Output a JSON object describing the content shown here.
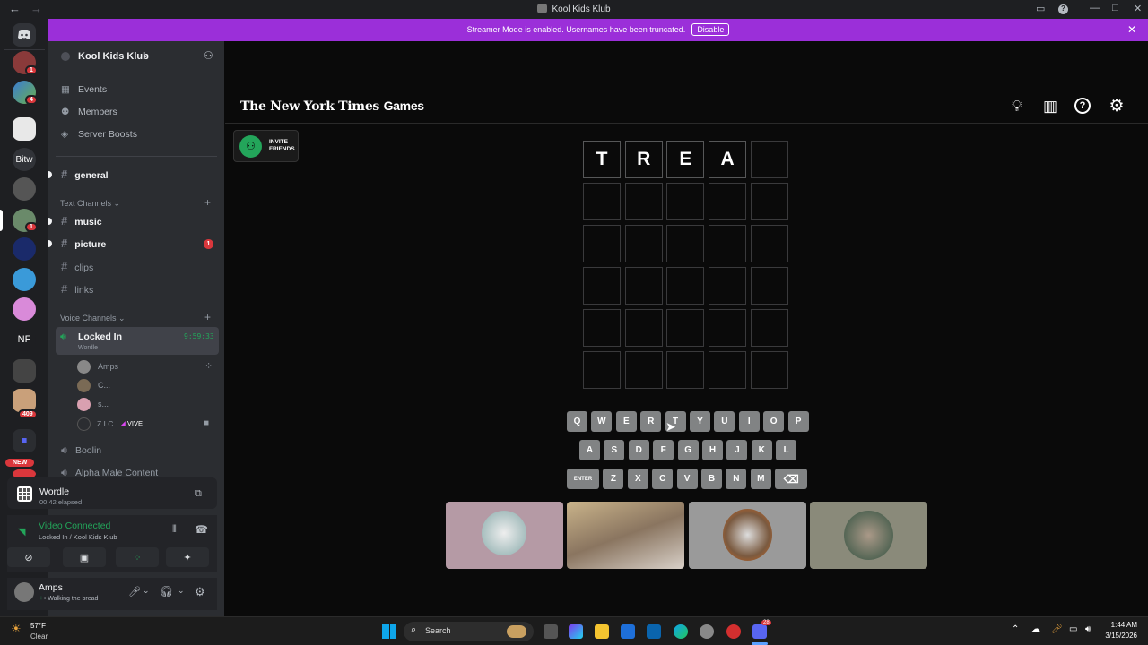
{
  "window": {
    "title": "Kool Kids Klub"
  },
  "banner": {
    "text": "Streamer Mode is enabled. Usernames have been truncated.",
    "button": "Disable"
  },
  "rail": {
    "text_server_1": "Bitw",
    "text_server_2": "NF",
    "new_badge": "NEW",
    "badge_1": "1",
    "badge_4": "4",
    "badge_409": "409"
  },
  "server": {
    "name": "Kool Kids Klub"
  },
  "nav": {
    "events": "Events",
    "members": "Members",
    "boosts": "Server Boosts"
  },
  "channels": {
    "general": "general",
    "text_category": "Text Channels",
    "text": [
      {
        "name": "music",
        "unread": true
      },
      {
        "name": "picture",
        "unread": true,
        "badge": "1"
      },
      {
        "name": "clips",
        "unread": false
      },
      {
        "name": "links",
        "unread": false
      }
    ],
    "voice_category": "Voice Channels",
    "voice_active": {
      "name": "Locked In",
      "activity": "Wordle",
      "timer": "9:59:33"
    },
    "voice_users": [
      {
        "name": "Amps"
      },
      {
        "name": "C..."
      },
      {
        "name": "s..."
      },
      {
        "name": "Z.I.C",
        "tag": "VIVE"
      }
    ],
    "voice_other": [
      {
        "name": "Boolin"
      },
      {
        "name": "Alpha Male Content"
      }
    ]
  },
  "activity_panel": {
    "name": "Wordle",
    "elapsed": "00:42 elapsed"
  },
  "voice_panel": {
    "status": "Video Connected",
    "location": "Locked In / Kool Kids Klub"
  },
  "user_panel": {
    "name": "Amps",
    "status": "• Walking the bread"
  },
  "game": {
    "logo": "The New York Times",
    "logo_games": "Games",
    "invite": "INVITE FRIENDS",
    "board": [
      [
        "T",
        "R",
        "E",
        "A",
        ""
      ],
      [
        "",
        "",
        "",
        "",
        ""
      ],
      [
        "",
        "",
        "",
        "",
        ""
      ],
      [
        "",
        "",
        "",
        "",
        ""
      ],
      [
        "",
        "",
        "",
        "",
        ""
      ],
      [
        "",
        "",
        "",
        "",
        ""
      ]
    ],
    "keyboard": [
      [
        "Q",
        "W",
        "E",
        "R",
        "T",
        "Y",
        "U",
        "I",
        "O",
        "P"
      ],
      [
        "A",
        "S",
        "D",
        "F",
        "G",
        "H",
        "J",
        "K",
        "L"
      ],
      [
        "ENTER",
        "Z",
        "X",
        "C",
        "V",
        "B",
        "N",
        "M",
        "⌫"
      ]
    ]
  },
  "taskbar": {
    "temp": "57°F",
    "weather": "Clear",
    "search": "Search",
    "time": "1:44 AM",
    "date": "3/15/2026",
    "discord_badge": "28"
  },
  "colors": {
    "banner": "#9b2fd9",
    "accent_green": "#23a55a",
    "tile_border": "#3a3a3c",
    "key": "#818384",
    "badge_red": "#da373c"
  }
}
